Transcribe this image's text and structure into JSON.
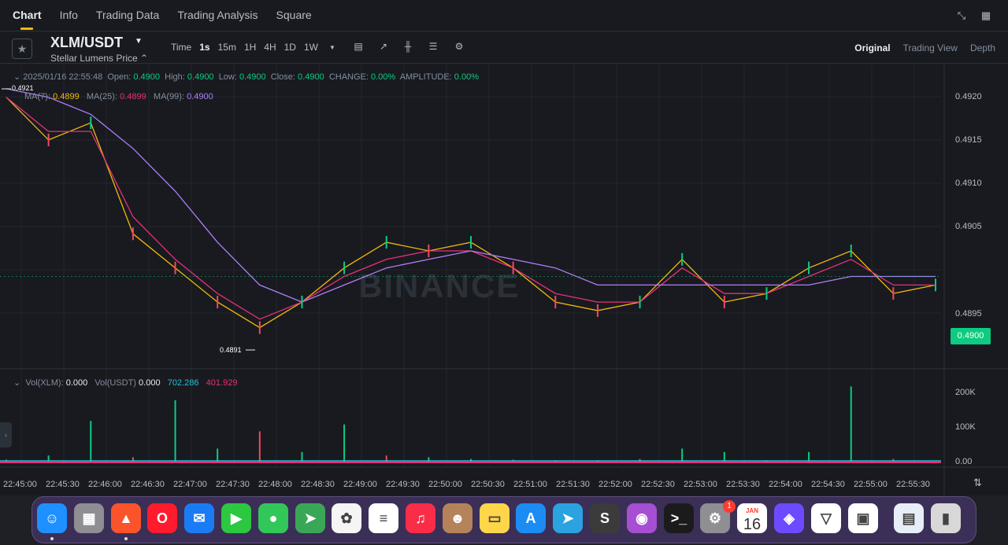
{
  "topnav": {
    "tabs": [
      "Chart",
      "Info",
      "Trading Data",
      "Trading Analysis",
      "Square"
    ],
    "active": "Chart",
    "icons": [
      "collapse-icon",
      "grid-icon"
    ]
  },
  "symbol": {
    "pair": "XLM/USDT",
    "subtitle": "Stellar Lumens Price ⌃",
    "intervals": [
      "Time",
      "1s",
      "15m",
      "1H",
      "4H",
      "1D",
      "1W"
    ],
    "selected_interval": "1s",
    "tool_icons": [
      "calendar-icon",
      "indicator-icon",
      "candle-type-icon",
      "layout-icon",
      "settings-icon"
    ],
    "views": [
      "Original",
      "Trading View",
      "Depth"
    ],
    "selected_view": "Original"
  },
  "ohlc": {
    "datetime": "2025/01/16 22:55:48",
    "open_label": "Open:",
    "open": "0.4900",
    "high_label": "High:",
    "high": "0.4900",
    "low_label": "Low:",
    "low": "0.4900",
    "close_label": "Close:",
    "close": "0.4900",
    "change_label": "CHANGE:",
    "change": "0.00%",
    "amplitude_label": "AMPLITUDE:",
    "amplitude": "0.00%"
  },
  "ma": {
    "ma7_label": "MA(7):",
    "ma7": "0.4899",
    "ma25_label": "MA(25):",
    "ma25": "0.4899",
    "ma99_label": "MA(99):",
    "ma99": "0.4900",
    "colors": {
      "ma7": "#f0b90b",
      "ma25": "#e6317a",
      "ma99": "#b07ff5"
    }
  },
  "volume": {
    "xlm_label": "Vol(XLM):",
    "xlm": "0.000",
    "usdt_label": "Vol(USDT)",
    "usdt": "0.000",
    "ma1": "702.286",
    "ma2": "401.929",
    "axis": [
      "200K",
      "100K",
      "0.00"
    ]
  },
  "price_axis": [
    "0.4920",
    "0.4915",
    "0.4910",
    "0.4905",
    "0.4900",
    "0.4895"
  ],
  "current_price": "0.4900",
  "high_marker": "0.4921",
  "low_marker": "0.4891",
  "watermark": "BINANCE",
  "time_axis": [
    "22:45:00",
    "22:45:30",
    "22:46:00",
    "22:46:30",
    "22:47:00",
    "22:47:30",
    "22:48:00",
    "22:48:30",
    "22:49:00",
    "22:49:30",
    "22:50:00",
    "22:50:30",
    "22:51:00",
    "22:51:30",
    "22:52:00",
    "22:52:30",
    "22:53:00",
    "22:53:30",
    "22:54:00",
    "22:54:30",
    "22:55:00",
    "22:55:30"
  ],
  "colors": {
    "up": "#0ecb81",
    "down": "#f6465d",
    "accent": "#f0b90b",
    "background": "#181a20"
  },
  "chart_data": {
    "type": "line",
    "ylim": [
      0.489,
      0.4923
    ],
    "x": [
      "22:45:00",
      "22:45:30",
      "22:46:00",
      "22:46:30",
      "22:47:00",
      "22:47:30",
      "22:48:00",
      "22:48:30",
      "22:49:00",
      "22:49:30",
      "22:50:00",
      "22:50:30",
      "22:51:00",
      "22:51:30",
      "22:52:00",
      "22:52:30",
      "22:53:00",
      "22:53:30",
      "22:54:00",
      "22:54:30",
      "22:55:00",
      "22:55:30",
      "22:55:48"
    ],
    "series": [
      {
        "name": "MA(7)",
        "values": [
          0.4921,
          0.4916,
          0.4918,
          0.4905,
          0.4901,
          0.4897,
          0.4894,
          0.4897,
          0.4901,
          0.4904,
          0.4903,
          0.4904,
          0.4901,
          0.4897,
          0.4896,
          0.4897,
          0.4902,
          0.4897,
          0.4898,
          0.4901,
          0.4903,
          0.4898,
          0.4899
        ]
      },
      {
        "name": "MA(25)",
        "values": [
          0.4921,
          0.4917,
          0.4917,
          0.4907,
          0.4902,
          0.4898,
          0.4895,
          0.4897,
          0.49,
          0.4902,
          0.4903,
          0.4903,
          0.4901,
          0.4898,
          0.4897,
          0.4897,
          0.4901,
          0.4898,
          0.4898,
          0.49,
          0.4902,
          0.4899,
          0.4899
        ]
      },
      {
        "name": "MA(99)",
        "values": [
          0.4922,
          0.4921,
          0.4919,
          0.4915,
          0.491,
          0.4904,
          0.4899,
          0.4897,
          0.4899,
          0.4901,
          0.4902,
          0.4903,
          0.4902,
          0.4901,
          0.4899,
          0.4899,
          0.4899,
          0.4899,
          0.4899,
          0.4899,
          0.49,
          0.49,
          0.49
        ]
      }
    ],
    "volume_bars_usdt": [
      8,
      20,
      120,
      15,
      180,
      40,
      90,
      30,
      110,
      20,
      15,
      10,
      8,
      6,
      6,
      10,
      40,
      30,
      5,
      30,
      220,
      10,
      2
    ]
  },
  "dock": {
    "apps": [
      "Finder",
      "Launchpad",
      "Brave",
      "Opera",
      "Mail",
      "FaceTime",
      "Messages",
      "Maps",
      "Photos",
      "Reminders",
      "Music",
      "Contacts",
      "Notes",
      "App Store",
      "Telegram",
      "Sublime Text",
      "Podcasts",
      "Terminal",
      "System Settings",
      "Calendar",
      "Proton VPN",
      "Proton",
      "Office",
      "Preview",
      "Trash"
    ],
    "calendar_month": "JAN",
    "calendar_day": "16",
    "settings_badge": "1"
  }
}
